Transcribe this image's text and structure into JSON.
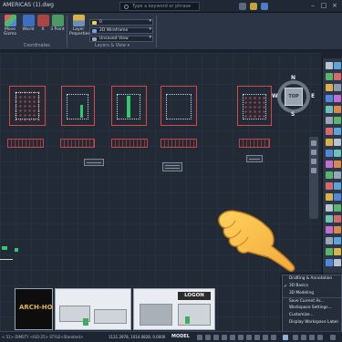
{
  "titlebar": {
    "doc_title": "AMERICAS (1).dwg",
    "search_placeholder": "Type a keyword or phrase"
  },
  "ribbon": {
    "buttons": {
      "move_gizmo": "Move\nGizmo",
      "world": "World",
      "x": "X",
      "three_point": "3 Point",
      "layer_properties": "Layer\nProperties"
    },
    "groups": {
      "coordinates": "Coordinates",
      "layers_view": "Layers & View ▾"
    },
    "combos": {
      "layer": "0",
      "visual_style": "2D Wireframe",
      "view": "Unsaved View"
    }
  },
  "viewcube": {
    "top": "TOP",
    "n": "N",
    "s": "S",
    "e": "E",
    "w": "W"
  },
  "thumbnails": {
    "logo": "ARCH-HOG",
    "sign": "LOGON"
  },
  "workspace_menu": {
    "items": [
      "Drafting & Annotation",
      "3D Basics",
      "3D Modeling",
      "Save Current As...",
      "Workspace Settings...",
      "Customize...",
      "Display Workspace Label"
    ],
    "checked_item": "3D Basics"
  },
  "statusbar": {
    "command": "< 51> DIMSTY <ISO-25> STYLE<Standard>",
    "coords": "1121.2978, 1014.0828, 0.0000",
    "model": "MODEL"
  },
  "colors": {
    "accent_red": "#d44848",
    "accent_green": "#35c86b",
    "ui_dark": "#222a36"
  }
}
